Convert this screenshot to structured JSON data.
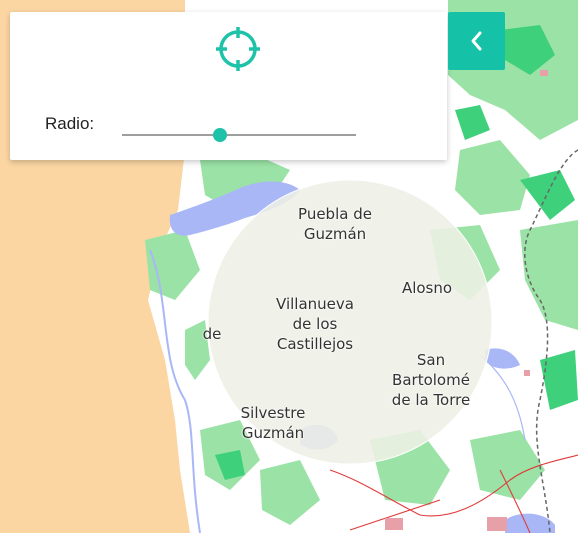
{
  "map": {
    "places": [
      {
        "name": "Puebla de\nGuzmán",
        "key": "puebla"
      },
      {
        "name": "Alosno",
        "key": "alosno"
      },
      {
        "name": "Villanueva\nde los\nCastillejos",
        "key": "villanueva"
      },
      {
        "name": "San\nBartolomé\nde la Torre",
        "key": "sanbartolome"
      },
      {
        "name": "Silvestre\nGuzmán",
        "key": "silvestre"
      },
      {
        "name": "de",
        "key": "partial"
      }
    ],
    "colors": {
      "land": "#ffffff",
      "sea": "#fbd6a2",
      "forest": "#9be2a6",
      "forest_dark": "#3ed07a",
      "water": "#aab7f7",
      "rail": "#666666",
      "road": "#e03a3a",
      "urban": "#e8a0a8"
    }
  },
  "panel": {
    "locate_icon": "crosshair-icon",
    "radio_label": "Radio:",
    "radio_value": 0.42,
    "accent": "#1ec2a8"
  },
  "collapse_button": {
    "icon": "chevron-left-icon",
    "color": "#15c2a8"
  }
}
